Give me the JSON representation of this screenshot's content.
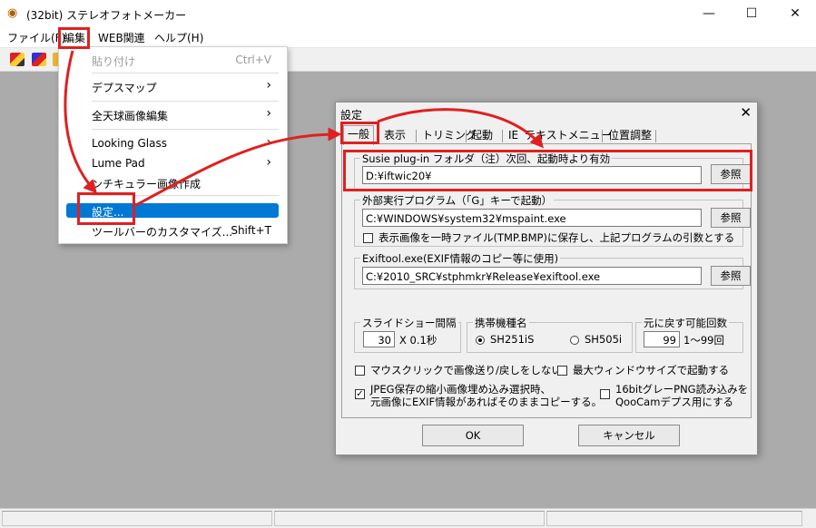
{
  "window": {
    "title": "(32bit) ステレオフォトメーカー",
    "controls": {
      "minimize": "—",
      "maximize": "☐",
      "close": "✕"
    }
  },
  "menubar": {
    "items": [
      {
        "label": "ファイル(F)"
      },
      {
        "label": "編集"
      },
      {
        "label": "WEB関連"
      },
      {
        "label": "ヘルプ(H)"
      }
    ]
  },
  "edit_menu": {
    "paste": {
      "label": "貼り付け",
      "shortcut": "Ctrl+V"
    },
    "depth_map": {
      "label": "デプスマップ"
    },
    "panorama": {
      "label": "全天球画像編集"
    },
    "looking_glass": {
      "label": "Looking Glass"
    },
    "lume_pad": {
      "label": "Lume Pad"
    },
    "anaglyph": {
      "label": "ンチキュラー画像作成"
    },
    "settings": {
      "label": "設定..."
    },
    "toolbar_custom": {
      "label": "ツールバーのカスタマイズ...",
      "shortcut": "Shift+T"
    },
    "submenu_arrow": "›"
  },
  "dialog": {
    "title": "設定",
    "close": "✕",
    "tabs": [
      "一般",
      "表示",
      "トリミング",
      "起動",
      "IE",
      "テキストメニュー",
      "位置調整"
    ],
    "susie": {
      "label": "Susie plug-in フォルダ（注）次回、起動時より有効",
      "value": "D:¥iftwic20¥",
      "browse": "参照"
    },
    "external": {
      "label": "外部実行プログラム（「G」キーで起動）",
      "value": "C:¥WINDOWS¥system32¥mspaint.exe",
      "browse": "参照",
      "temp_checkbox": "表示画像を一時ファイル(TMP.BMP)に保存し、上記プログラムの引数とする"
    },
    "exiftool": {
      "label": "Exiftool.exe(EXIF情報のコピー等に使用)",
      "value": "C:¥2010_SRC¥stphmkr¥Release¥exiftool.exe",
      "browse": "参照"
    },
    "slideshow": {
      "label": "スライドショー間隔",
      "value": "30",
      "unit": "X 0.1秒"
    },
    "phone": {
      "label": "携帯機種名",
      "option1": "SH251iS",
      "option2": "SH505i"
    },
    "undo": {
      "label": "元に戻す可能回数",
      "value": "99",
      "range": "1〜99回"
    },
    "options": {
      "mouse_click": "マウスクリックで画像送り/戻しをしない",
      "max_window": "最大ウィンドウサイズで起動する",
      "jpeg_line1": "JPEG保存の縮小画像埋め込み選択時、",
      "jpeg_line2": "元画像にEXIF情報があればそのままコピーする。",
      "png_line1": "16bitグレーPNG読み込みを",
      "png_line2": "QooCamデプス用にする",
      "checkmark": "✓"
    },
    "ok": "OK",
    "cancel": "キャンセル"
  },
  "colors": {
    "highlight": "#e02020",
    "menu_selection": "#0078d4",
    "workspace": "#ababab"
  },
  "icons": {
    "app": "stereo-camera-icon",
    "submenu": "chevron-right-icon",
    "toolbar": [
      "open-icon",
      "save-icon",
      "folder-icon"
    ]
  }
}
